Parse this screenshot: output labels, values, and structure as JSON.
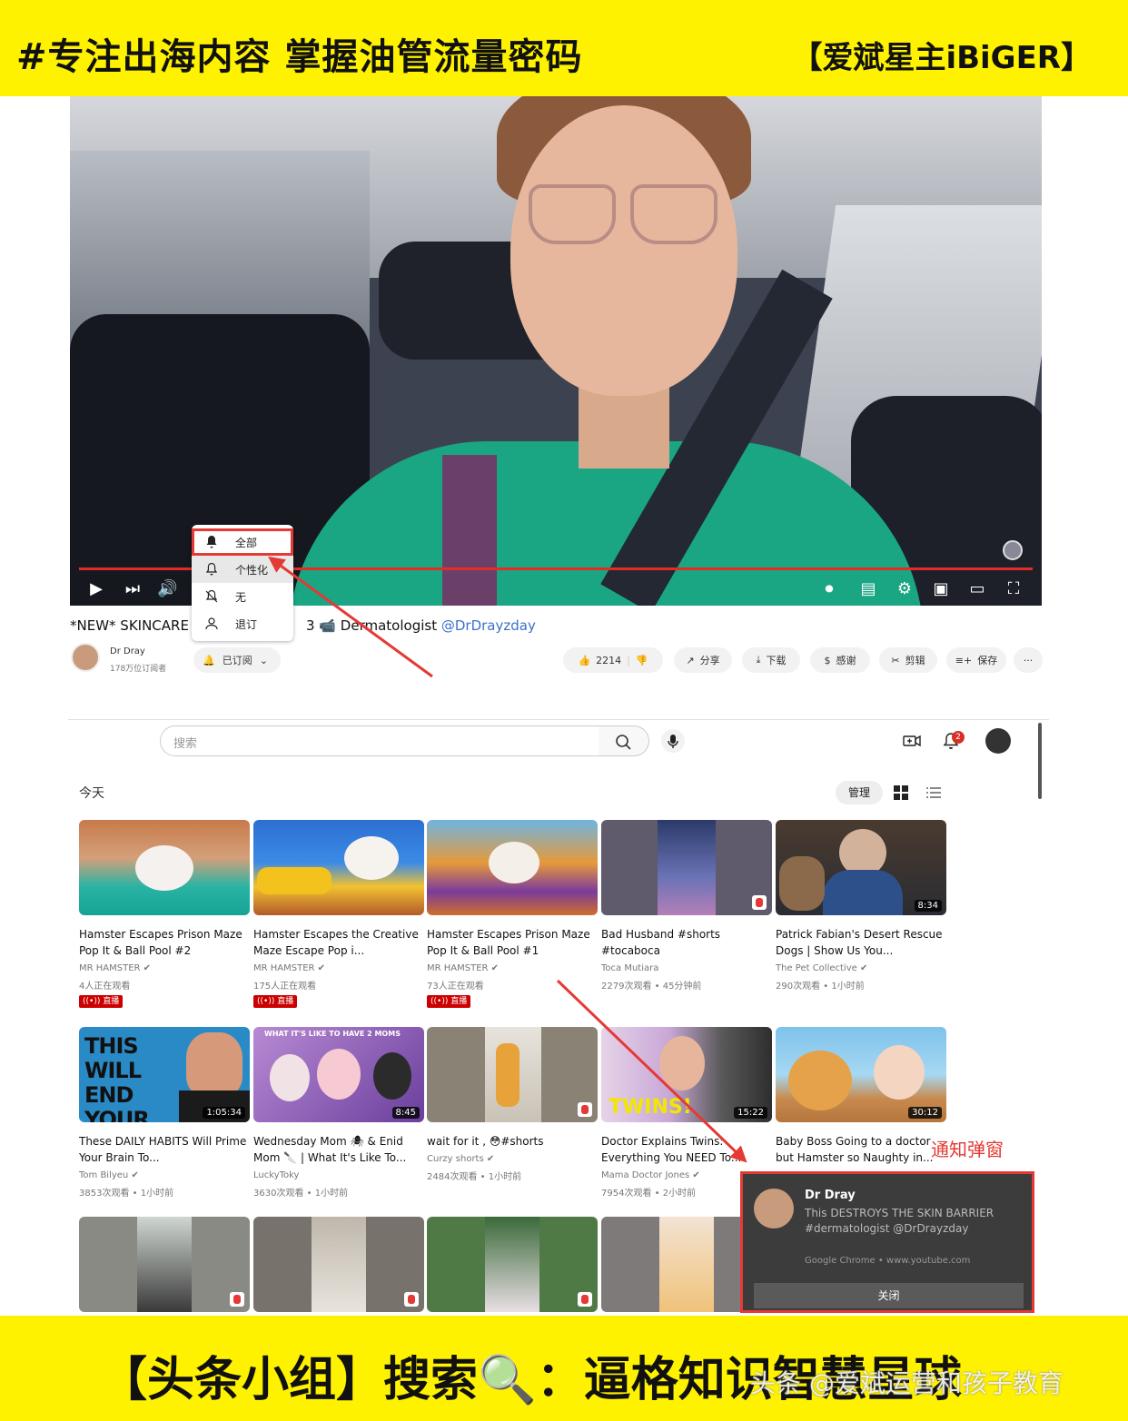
{
  "banner": {
    "top_left": "#专注出海内容 掌握油管流量密码",
    "top_right": "【爱斌星主iBiGER】",
    "bottom": "【头条小组】搜索🔍：逼格知识智慧星球",
    "watermark": "头条 @爱斌运营和孩子教育"
  },
  "player": {
    "bell_menu": [
      {
        "label": "全部",
        "icon": "bell-filled-icon"
      },
      {
        "label": "个性化",
        "icon": "bell-icon"
      },
      {
        "label": "无",
        "icon": "bell-off-icon"
      },
      {
        "label": "退订",
        "icon": "person-remove-icon"
      }
    ]
  },
  "video": {
    "title_prefix": "*NEW* SKINCARE .",
    "title_mid": "3 📹 Dermatologist",
    "title_mention": "@DrDrayzday",
    "channel_name": "Dr Dray",
    "subscribers": "178万位订阅者",
    "subscribed_label": "已订阅",
    "like_count": "2214",
    "share": "分享",
    "download": "下载",
    "thanks": "感谢",
    "clip": "剪辑",
    "save": "保存",
    "more": "···"
  },
  "yt": {
    "search_placeholder": "搜索",
    "notif_count": "2",
    "section_today": "今天",
    "manage": "管理"
  },
  "cards_row1": [
    {
      "title": "Hamster Escapes Prison Maze Pop It & Ball Pool #2",
      "channel": "MR HAMSTER",
      "meta": "4人正在观看",
      "live": "((•)) 直播"
    },
    {
      "title": "Hamster Escapes the Creative Maze Escape Pop i...",
      "channel": "MR HAMSTER",
      "meta": "175人正在观看",
      "live": "((•)) 直播"
    },
    {
      "title": "Hamster Escapes Prison Maze Pop It & Ball Pool #1",
      "channel": "MR HAMSTER",
      "meta": "73人正在观看",
      "live": "((•)) 直播"
    },
    {
      "title": "Bad Husband #shorts #tocaboca",
      "channel": "Toca Mutiara",
      "meta": "2279次观看 • 45分钟前"
    },
    {
      "title": "Patrick Fabian's Desert Rescue Dogs | Show Us You...",
      "channel": "The Pet Collective",
      "meta": "290次观看 • 1小时前",
      "duration": "8:34"
    }
  ],
  "cards_row2": [
    {
      "title": "These DAILY HABITS Will Prime Your Brain To...",
      "channel": "Tom Bilyeu",
      "meta": "3853次观看 • 1小时前",
      "duration": "1:05:34",
      "thumb_text": "THIS WILL END YOUR ANXIETY"
    },
    {
      "title": "Wednesday Mom 🕷 & Enid Mom 🔪 | What It's Like To...",
      "channel": "LuckyToky",
      "meta": "3630次观看 • 1小时前",
      "duration": "8:45",
      "thumb_text": "WHAT IT'S LIKE TO HAVE 2 MOMS"
    },
    {
      "title": "wait for it , 😳#shorts",
      "channel": "Curzy shorts",
      "meta": "2484次观看 • 1小时前"
    },
    {
      "title": "Doctor Explains Twins: Everything You NEED To...",
      "channel": "Mama Doctor Jones",
      "meta": "7954次观看 • 2小时前",
      "duration": "15:22",
      "thumb_text": "TWINS!"
    },
    {
      "title": "Baby Boss Going to a doctor but Hamster so Naughty in...",
      "channel": "",
      "meta": "",
      "duration": "30:12"
    }
  ],
  "notification": {
    "label": "通知弹窗",
    "name": "Dr Dray",
    "body": "This DESTROYS THE SKIN BARRIER #dermatologist @DrDrayzday",
    "source": "Google Chrome • www.youtube.com",
    "close": "关闭"
  },
  "colors": {
    "banner": "#fff200",
    "accent_red": "#e53935",
    "live_red": "#cc0000"
  }
}
